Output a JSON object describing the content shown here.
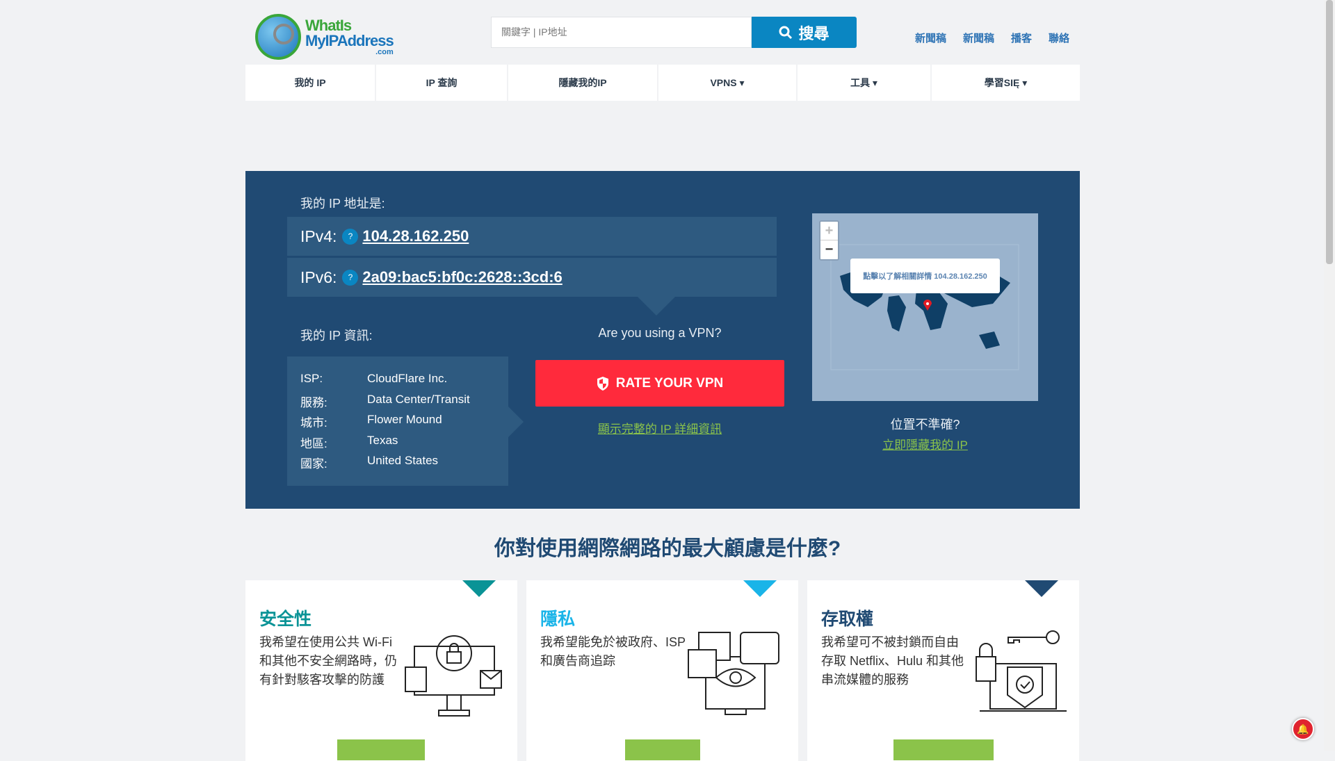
{
  "header": {
    "logo_text_1": "WhatIs",
    "logo_text_2": "MyIPAddress",
    "logo_text_3": ".com",
    "search_placeholder": "關鍵字 | IP地址",
    "search_button": "搜尋",
    "top_links": [
      "新聞稿",
      "新聞稿",
      "播客",
      "聯絡"
    ]
  },
  "nav": [
    {
      "label": "我的 IP"
    },
    {
      "label": "IP 查詢"
    },
    {
      "label": "隱藏我的IP"
    },
    {
      "label": "VPNS ▾"
    },
    {
      "label": "工具 ▾"
    },
    {
      "label": "學習SIĘ ▾"
    }
  ],
  "ip_panel": {
    "title": "我的 IP 地址是:",
    "ipv4_label": "IPv4:",
    "ipv4": "104.28.162.250",
    "ipv6_label": "IPv6:",
    "ipv6": "2a09:bac5:bf0c:2628::3cd:6",
    "help": "?",
    "info_title": "我的 IP 資訊:",
    "info": [
      {
        "k": "ISP:",
        "v": "CloudFlare Inc."
      },
      {
        "k": "服務:",
        "v": "Data Center/Transit"
      },
      {
        "k": "城市:",
        "v": "Flower Mound"
      },
      {
        "k": "地區:",
        "v": "Texas"
      },
      {
        "k": "國家:",
        "v": "United States"
      }
    ],
    "vpn_question": "Are you using a VPN?",
    "vpn_button": "RATE YOUR VPN",
    "details_link": "顯示完整的 IP 詳細資訊",
    "map_popup": "點擊以了解相關詳情 104.28.162.250",
    "zoom_in": "+",
    "zoom_out": "−",
    "inaccurate": "位置不準確?",
    "hide_link": "立即隱藏我的 IP"
  },
  "concerns": {
    "heading": "你對使用網際網路的最大顧慮是什麼?",
    "cards": [
      {
        "title": "安全性",
        "text": "我希望在使用公共 Wi-Fi 和其他不安全網路時，仍有針對駭客攻擊的防護",
        "color": "#0a9396"
      },
      {
        "title": "隱私",
        "text": "我希望能免於被政府、ISP 和廣告商追踪",
        "color": "#1ab4e8"
      },
      {
        "title": "存取權",
        "text": "我希望可不被封鎖而自由存取 Netflix、Hulu 和其他串流媒體的服務",
        "color": "#204a73"
      }
    ]
  },
  "colors": {
    "panel": "#204a73",
    "accent_red": "#ff2a3c",
    "link_green": "#8bc34a",
    "brand_blue": "#0a86c2"
  }
}
